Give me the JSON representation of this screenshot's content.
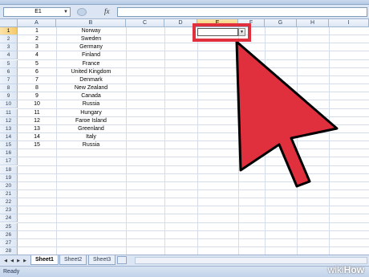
{
  "formula_bar": {
    "name_box": "E1",
    "name_box_icon": "chevron-down-icon",
    "fx_label": "fx",
    "formula": ""
  },
  "columns": [
    "A",
    "B",
    "C",
    "D",
    "E",
    "F",
    "G",
    "H",
    "I"
  ],
  "active_column": "E",
  "active_row": "1",
  "rows": [
    {
      "num": "1",
      "a": "1",
      "b": "Norway"
    },
    {
      "num": "2",
      "a": "2",
      "b": "Sweden"
    },
    {
      "num": "3",
      "a": "3",
      "b": "Germany"
    },
    {
      "num": "4",
      "a": "4",
      "b": "Finland"
    },
    {
      "num": "5",
      "a": "5",
      "b": "France"
    },
    {
      "num": "6",
      "a": "6",
      "b": "United Kingdom"
    },
    {
      "num": "7",
      "a": "7",
      "b": "Denmark"
    },
    {
      "num": "8",
      "a": "8",
      "b": "New Zealand"
    },
    {
      "num": "9",
      "a": "9",
      "b": "Canada"
    },
    {
      "num": "10",
      "a": "10",
      "b": "Russia"
    },
    {
      "num": "11",
      "a": "11",
      "b": "Hungary"
    },
    {
      "num": "12",
      "a": "12",
      "b": "Faroe Island"
    },
    {
      "num": "13",
      "a": "13",
      "b": "Greenland"
    },
    {
      "num": "14",
      "a": "14",
      "b": "Italy"
    },
    {
      "num": "15",
      "a": "15",
      "b": "Russia"
    },
    {
      "num": "16",
      "a": "",
      "b": ""
    },
    {
      "num": "17",
      "a": "",
      "b": ""
    },
    {
      "num": "18",
      "a": "",
      "b": ""
    },
    {
      "num": "19",
      "a": "",
      "b": ""
    },
    {
      "num": "20",
      "a": "",
      "b": ""
    },
    {
      "num": "21",
      "a": "",
      "b": ""
    },
    {
      "num": "22",
      "a": "",
      "b": ""
    },
    {
      "num": "23",
      "a": "",
      "b": ""
    },
    {
      "num": "24",
      "a": "",
      "b": ""
    },
    {
      "num": "25",
      "a": "",
      "b": ""
    },
    {
      "num": "26",
      "a": "",
      "b": ""
    },
    {
      "num": "27",
      "a": "",
      "b": ""
    },
    {
      "num": "28",
      "a": "",
      "b": ""
    }
  ],
  "sheets": [
    "Sheet1",
    "Sheet2",
    "Sheet3"
  ],
  "active_sheet": "Sheet1",
  "status": "Ready",
  "watermark": {
    "prefix": "wiki",
    "suffix": "How"
  },
  "colors": {
    "highlight": "#e0303e",
    "arrow_fill": "#e0303e",
    "header_active": "#f5c96a"
  }
}
